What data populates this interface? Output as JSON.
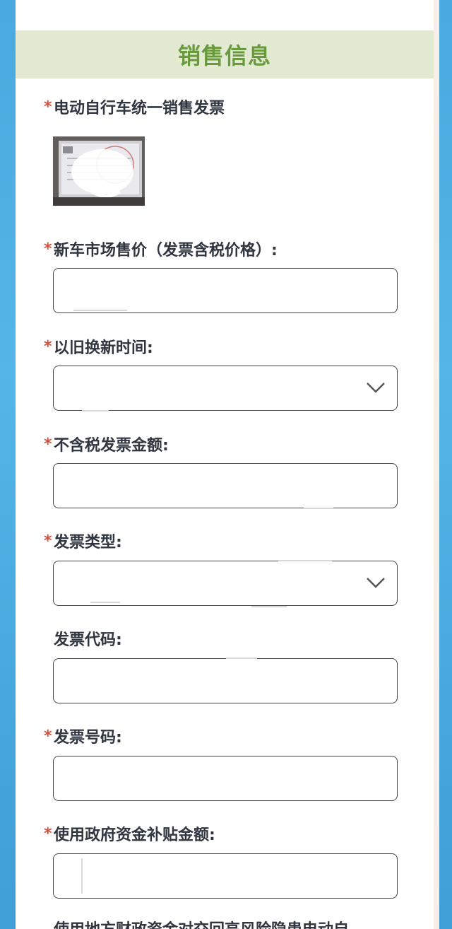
{
  "section": {
    "title": "销售信息"
  },
  "fields": [
    {
      "label": "电动自行车统一销售发票",
      "required": true,
      "type": "image"
    },
    {
      "label": "新车市场售价（发票含税价格）:",
      "required": true,
      "type": "input",
      "value": ""
    },
    {
      "label": "以旧换新时间:",
      "required": true,
      "type": "select",
      "value": ""
    },
    {
      "label": "不含税发票金额:",
      "required": true,
      "type": "input",
      "value": ""
    },
    {
      "label": "发票类型:",
      "required": true,
      "type": "select",
      "value": ""
    },
    {
      "label": "发票代码:",
      "required": false,
      "type": "input",
      "value": ""
    },
    {
      "label": "发票号码:",
      "required": true,
      "type": "input",
      "value": ""
    },
    {
      "label": "使用政府资金补贴金额:",
      "required": true,
      "type": "input",
      "value": ""
    }
  ],
  "required_mark": "*",
  "truncated_label": "使用地方财政资金对交回高风险隐患电动自",
  "icons": {
    "select_arrow": "chevron-down-icon",
    "invoice_image": "invoice-photo-thumbnail"
  },
  "colors": {
    "header_bg": "#e2ebd2",
    "header_text": "#6a9a3e",
    "required": "#d4503c",
    "background": "#4aa9de"
  }
}
